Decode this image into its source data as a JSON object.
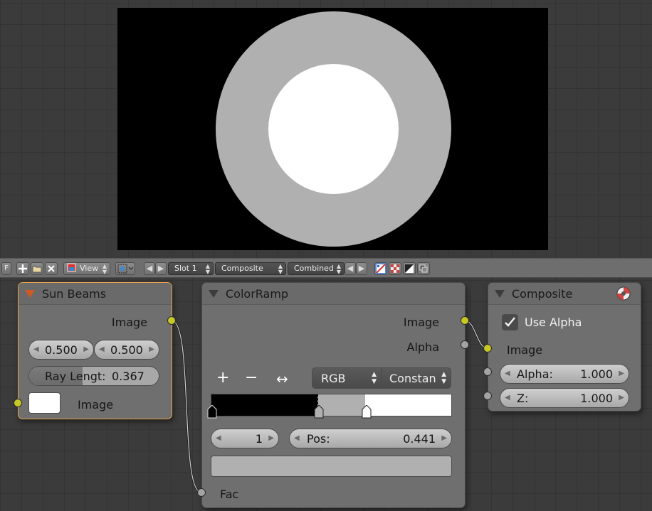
{
  "toolbar": {
    "f_label": "F",
    "view_label": "View",
    "slot_label": "Slot 1",
    "composite_label": "Composite",
    "combined_label": "Combined"
  },
  "sun_beams": {
    "title": "Sun Beams",
    "output_image": "Image",
    "source_x": "0.500",
    "source_y": "0.500",
    "ray_length_label": "Ray Lengt:",
    "ray_length_value": "0.367",
    "ray_length_fraction": 0.367,
    "input_image": "Image",
    "color_swatch": "#ffffff"
  },
  "color_ramp": {
    "title": "ColorRamp",
    "output_image": "Image",
    "output_alpha": "Alpha",
    "add_button": "+",
    "remove_button": "−",
    "flip_button": "↔",
    "color_mode": "RGB",
    "interpolation": "Constan",
    "active_stop_index": "1",
    "pos_label": "Pos:",
    "pos_value": "0.441",
    "input_fac": "Fac",
    "stops": [
      {
        "pos": 0.0,
        "color": "#000000"
      },
      {
        "pos": 0.441,
        "color": "#b0b0b0"
      },
      {
        "pos": 0.64,
        "color": "#ffffff"
      }
    ]
  },
  "composite": {
    "title": "Composite",
    "use_alpha_label": "Use Alpha",
    "use_alpha_checked": true,
    "input_image": "Image",
    "alpha_label": "Alpha:",
    "alpha_value": "1.000",
    "z_label": "Z:",
    "z_value": "1.000"
  },
  "colors": {
    "socket_color": "#c8c824",
    "socket_gray": "#a3a3a3",
    "active_border": "#e8a24a",
    "ring": "#b0b0b0"
  }
}
